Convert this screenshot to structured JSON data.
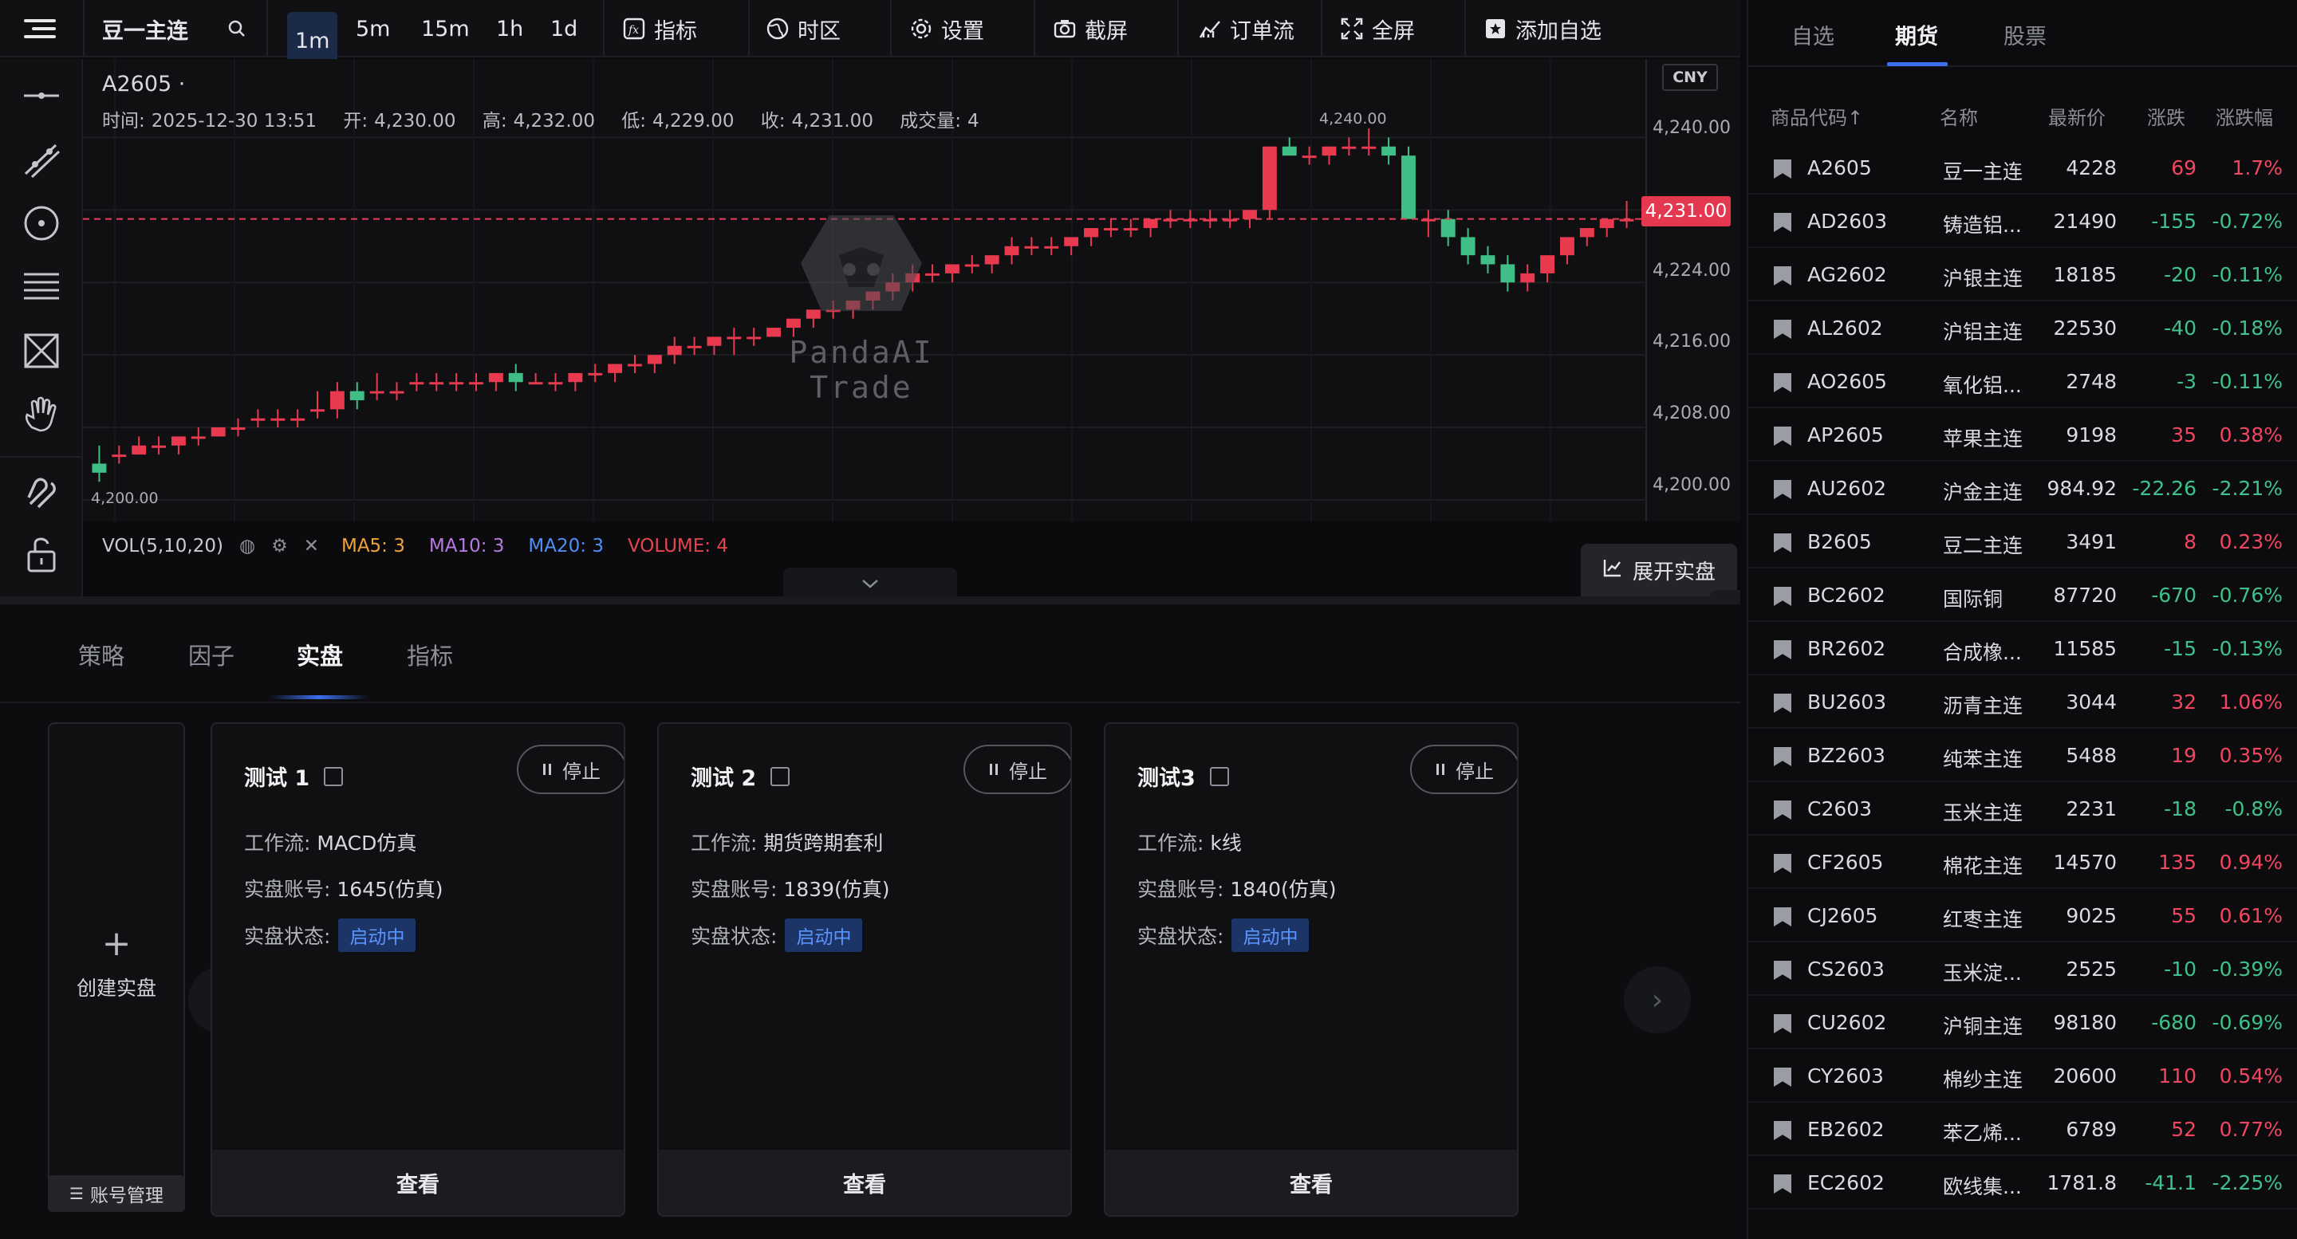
{
  "toolbar": {
    "symbol": "豆一主连",
    "timeframes": [
      "1m",
      "5m",
      "15m",
      "1h",
      "1d"
    ],
    "active_timeframe": "1m",
    "indicators_label": "指标",
    "timezone_label": "时区",
    "settings_label": "设置",
    "screenshot_label": "截屏",
    "orderflow_label": "订单流",
    "fullscreen_label": "全屏",
    "add_watch_label": "添加自选"
  },
  "chart": {
    "symbol_line": "A2605 ·",
    "time_label": "时间:",
    "time_value": "2025-12-30 13:51",
    "open_label": "开:",
    "open_value": "4,230.00",
    "high_label": "高:",
    "high_value": "4,232.00",
    "low_label": "低:",
    "low_value": "4,229.00",
    "close_label": "收:",
    "close_value": "4,231.00",
    "volume_label": "成交量:",
    "volume_value": "4",
    "currency": "CNY",
    "last_price_label": "4,231.00",
    "y_ticks": [
      "4,240.00",
      "4,232.00",
      "4,224.00",
      "4,216.00",
      "4,208.00",
      "4,200.00"
    ],
    "period_low_label": "4,200.00",
    "period_high_label": "4,240.00",
    "watermark": "PandaAI Trade",
    "colors": {
      "up": "#e8394f",
      "down": "#3fbf86",
      "last_price_line": "#e0405a"
    }
  },
  "chart_data": {
    "type": "candlestick",
    "title": "A2605",
    "xlabel": "",
    "ylabel": "",
    "ylim": [
      4198.5,
      4242.5
    ],
    "last_price": 4231,
    "candles": [
      [
        4204,
        4206,
        4202,
        4203
      ],
      [
        4205,
        4206,
        4204,
        4205
      ],
      [
        4205,
        4207,
        4205,
        4206
      ],
      [
        4206,
        4207,
        4205,
        4206
      ],
      [
        4206,
        4207,
        4205,
        4207
      ],
      [
        4207,
        4208,
        4206,
        4207
      ],
      [
        4207,
        4208,
        4207,
        4208
      ],
      [
        4208,
        4209,
        4207,
        4208
      ],
      [
        4209,
        4210,
        4208,
        4209
      ],
      [
        4209,
        4210,
        4208,
        4209
      ],
      [
        4209,
        4210,
        4208,
        4209
      ],
      [
        4210,
        4212,
        4209,
        4210
      ],
      [
        4210,
        4213,
        4209,
        4212
      ],
      [
        4212,
        4213,
        4210,
        4211
      ],
      [
        4212,
        4214,
        4211,
        4212
      ],
      [
        4212,
        4213,
        4211,
        4212
      ],
      [
        4213,
        4214,
        4212,
        4213
      ],
      [
        4213,
        4214,
        4212,
        4213
      ],
      [
        4213,
        4214,
        4212,
        4213
      ],
      [
        4213,
        4214,
        4212,
        4213
      ],
      [
        4213,
        4214,
        4212,
        4214
      ],
      [
        4214,
        4215,
        4212,
        4213
      ],
      [
        4213,
        4214,
        4213,
        4213
      ],
      [
        4213,
        4214,
        4212,
        4213
      ],
      [
        4213,
        4214,
        4212,
        4214
      ],
      [
        4214,
        4215,
        4213,
        4214
      ],
      [
        4214,
        4215,
        4213,
        4215
      ],
      [
        4215,
        4216,
        4214,
        4215
      ],
      [
        4215,
        4216,
        4214,
        4216
      ],
      [
        4216,
        4218,
        4215,
        4217
      ],
      [
        4217,
        4218,
        4216,
        4217
      ],
      [
        4217,
        4218,
        4216,
        4218
      ],
      [
        4218,
        4219,
        4216,
        4218
      ],
      [
        4218,
        4219,
        4217,
        4218
      ],
      [
        4218,
        4219,
        4218,
        4219
      ],
      [
        4219,
        4220,
        4218,
        4220
      ],
      [
        4220,
        4221,
        4219,
        4221
      ],
      [
        4221,
        4222,
        4220,
        4221
      ],
      [
        4221,
        4222,
        4220,
        4222
      ],
      [
        4222,
        4223,
        4221,
        4223
      ],
      [
        4223,
        4225,
        4222,
        4224
      ],
      [
        4224,
        4226,
        4223,
        4225
      ],
      [
        4225,
        4226,
        4224,
        4225
      ],
      [
        4225,
        4226,
        4224,
        4226
      ],
      [
        4226,
        4227,
        4225,
        4226
      ],
      [
        4226,
        4227,
        4225,
        4227
      ],
      [
        4227,
        4229,
        4226,
        4228
      ],
      [
        4228,
        4229,
        4227,
        4228
      ],
      [
        4228,
        4229,
        4227,
        4228
      ],
      [
        4228,
        4229,
        4227,
        4229
      ],
      [
        4229,
        4230,
        4228,
        4230
      ],
      [
        4230,
        4231,
        4229,
        4230
      ],
      [
        4230,
        4231,
        4229,
        4230
      ],
      [
        4230,
        4231,
        4229,
        4231
      ],
      [
        4231,
        4232,
        4230,
        4231
      ],
      [
        4231,
        4232,
        4230,
        4231
      ],
      [
        4231,
        4232,
        4230,
        4231
      ],
      [
        4231,
        4232,
        4230,
        4231
      ],
      [
        4231,
        4232,
        4230,
        4232
      ],
      [
        4232,
        4239,
        4231,
        4239
      ],
      [
        4239,
        4240,
        4238,
        4238
      ],
      [
        4238,
        4239,
        4237,
        4238
      ],
      [
        4238,
        4239,
        4237,
        4239
      ],
      [
        4239,
        4240,
        4238,
        4239
      ],
      [
        4239,
        4241,
        4238,
        4239
      ],
      [
        4239,
        4240,
        4237,
        4238
      ],
      [
        4238,
        4239,
        4236,
        4231
      ],
      [
        4231,
        4232,
        4229,
        4231
      ],
      [
        4231,
        4232,
        4228,
        4229
      ],
      [
        4229,
        4230,
        4226,
        4227
      ],
      [
        4227,
        4228,
        4225,
        4226
      ],
      [
        4226,
        4227,
        4223,
        4224
      ],
      [
        4224,
        4226,
        4223,
        4225
      ],
      [
        4225,
        4227,
        4224,
        4227
      ],
      [
        4227,
        4229,
        4226,
        4229
      ],
      [
        4229,
        4230,
        4228,
        4230
      ],
      [
        4230,
        4231,
        4229,
        4231
      ],
      [
        4231,
        4233,
        4230,
        4231
      ]
    ]
  },
  "volume_bar": {
    "label": "VOL(5,10,20)",
    "ma5": "MA5: 3",
    "ma10": "MA10: 3",
    "ma20": "MA20: 3",
    "volume": "VOLUME: 4",
    "expand_label": "展开实盘"
  },
  "bottom": {
    "tabs": [
      "策略",
      "因子",
      "实盘",
      "指标"
    ],
    "active_tab": "实盘",
    "create_label": "创建实盘",
    "account_mgmt_label": "账号管理",
    "workflow_label": "工作流:",
    "account_label": "实盘账号:",
    "status_label": "实盘状态:",
    "stop_label": "停止",
    "view_label": "查看",
    "cards": [
      {
        "title": "测试 1",
        "workflow": "MACD仿真",
        "account": "1645(仿真)",
        "status": "启动中"
      },
      {
        "title": "测试 2",
        "workflow": "期货跨期套利",
        "account": "1839(仿真)",
        "status": "启动中"
      },
      {
        "title": "测试3",
        "workflow": "k线",
        "account": "1840(仿真)",
        "status": "启动中"
      }
    ]
  },
  "watchlist": {
    "tabs": [
      "自选",
      "期货",
      "股票"
    ],
    "active_tab": "期货",
    "headers": {
      "code": "商品代码↑",
      "name": "名称",
      "price": "最新价",
      "change": "涨跌",
      "pct": "涨跌幅"
    },
    "rows": [
      {
        "code": "A2605",
        "name": "豆一主连",
        "price": "4228",
        "change": "69",
        "pct": "1.7%",
        "dir": "up"
      },
      {
        "code": "AD2603",
        "name": "铸造铝...",
        "price": "21490",
        "change": "-155",
        "pct": "-0.72%",
        "dir": "down"
      },
      {
        "code": "AG2602",
        "name": "沪银主连",
        "price": "18185",
        "change": "-20",
        "pct": "-0.11%",
        "dir": "down"
      },
      {
        "code": "AL2602",
        "name": "沪铝主连",
        "price": "22530",
        "change": "-40",
        "pct": "-0.18%",
        "dir": "down"
      },
      {
        "code": "AO2605",
        "name": "氧化铝...",
        "price": "2748",
        "change": "-3",
        "pct": "-0.11%",
        "dir": "down"
      },
      {
        "code": "AP2605",
        "name": "苹果主连",
        "price": "9198",
        "change": "35",
        "pct": "0.38%",
        "dir": "up"
      },
      {
        "code": "AU2602",
        "name": "沪金主连",
        "price": "984.92",
        "change": "-22.26",
        "pct": "-2.21%",
        "dir": "down"
      },
      {
        "code": "B2605",
        "name": "豆二主连",
        "price": "3491",
        "change": "8",
        "pct": "0.23%",
        "dir": "up"
      },
      {
        "code": "BC2602",
        "name": "国际铜",
        "price": "87720",
        "change": "-670",
        "pct": "-0.76%",
        "dir": "down"
      },
      {
        "code": "BR2602",
        "name": "合成橡...",
        "price": "11585",
        "change": "-15",
        "pct": "-0.13%",
        "dir": "down"
      },
      {
        "code": "BU2603",
        "name": "沥青主连",
        "price": "3044",
        "change": "32",
        "pct": "1.06%",
        "dir": "up"
      },
      {
        "code": "BZ2603",
        "name": "纯苯主连",
        "price": "5488",
        "change": "19",
        "pct": "0.35%",
        "dir": "up"
      },
      {
        "code": "C2603",
        "name": "玉米主连",
        "price": "2231",
        "change": "-18",
        "pct": "-0.8%",
        "dir": "down"
      },
      {
        "code": "CF2605",
        "name": "棉花主连",
        "price": "14570",
        "change": "135",
        "pct": "0.94%",
        "dir": "up"
      },
      {
        "code": "CJ2605",
        "name": "红枣主连",
        "price": "9025",
        "change": "55",
        "pct": "0.61%",
        "dir": "up"
      },
      {
        "code": "CS2603",
        "name": "玉米淀...",
        "price": "2525",
        "change": "-10",
        "pct": "-0.39%",
        "dir": "down"
      },
      {
        "code": "CU2602",
        "name": "沪铜主连",
        "price": "98180",
        "change": "-680",
        "pct": "-0.69%",
        "dir": "down"
      },
      {
        "code": "CY2603",
        "name": "棉纱主连",
        "price": "20600",
        "change": "110",
        "pct": "0.54%",
        "dir": "up"
      },
      {
        "code": "EB2602",
        "name": "苯乙烯...",
        "price": "6789",
        "change": "52",
        "pct": "0.77%",
        "dir": "up"
      },
      {
        "code": "EC2602",
        "name": "欧线集...",
        "price": "1781.8",
        "change": "-41.1",
        "pct": "-2.25%",
        "dir": "down"
      }
    ]
  }
}
